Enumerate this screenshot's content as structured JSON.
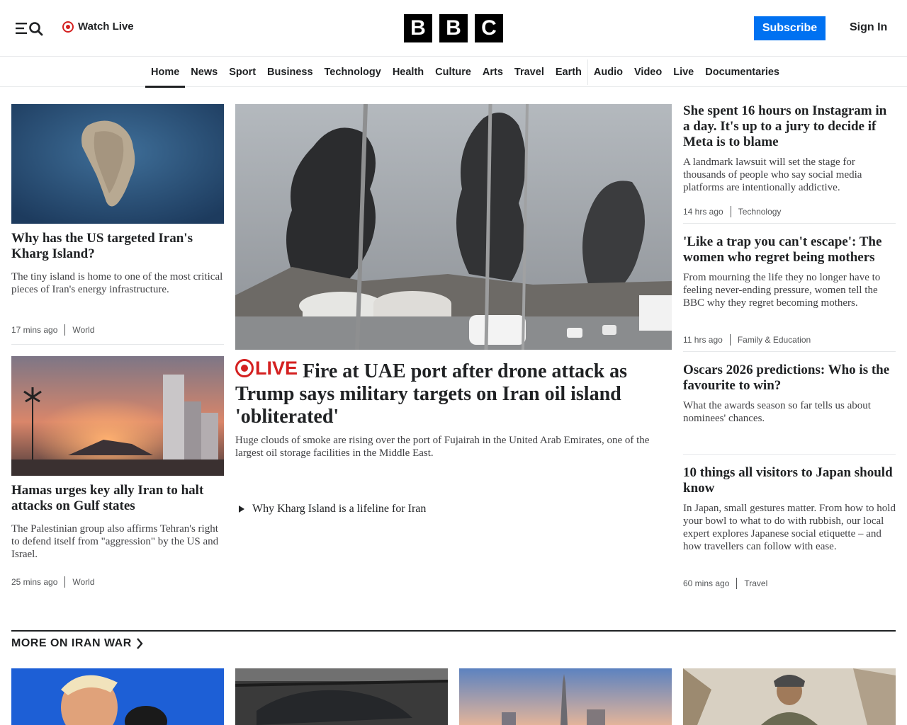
{
  "header": {
    "watch_live": "Watch Live",
    "logo_letters": [
      "B",
      "B",
      "C"
    ],
    "subscribe": "Subscribe",
    "sign_in": "Sign In",
    "accent": "#0071f1",
    "live_color": "#d42020"
  },
  "nav": {
    "items": [
      "Home",
      "News",
      "Sport",
      "Business",
      "Technology",
      "Health",
      "Culture",
      "Arts",
      "Travel",
      "Earth",
      "Audio",
      "Video",
      "Live",
      "Documentaries"
    ],
    "active": "Home"
  },
  "left": [
    {
      "headline": "Why has the US targeted Iran's Kharg Island?",
      "summary": "The tiny island is home to one of the most critical pieces of Iran's energy infrastructure.",
      "time": "17 mins ago",
      "section": "World"
    },
    {
      "headline": "Hamas urges key ally Iran to halt attacks on Gulf states",
      "summary": "The Palestinian group also affirms Tehran's right to defend itself from \"aggression\" by the US and Israel.",
      "time": "25 mins ago",
      "section": "World"
    }
  ],
  "main": {
    "live_label": "LIVE",
    "headline": "Fire at UAE port after drone attack as Trump says military targets on Iran oil island 'obliterated'",
    "summary": "Huge clouds of smoke are rising over the port of Fujairah in the United Arab Emirates, one of the largest oil storage facilities in the Middle East.",
    "related": "Why Kharg Island is a lifeline for Iran"
  },
  "right": [
    {
      "headline": "She spent 16 hours on Instagram in a day. It's up to a jury to decide if Meta is to blame",
      "summary": "A landmark lawsuit will set the stage for thousands of people who say social media platforms are intentionally addictive.",
      "time": "14 hrs ago",
      "section": "Technology"
    },
    {
      "headline": "'Like a trap you can't escape': The women who regret being mothers",
      "summary": "From mourning the life they no longer have to feeling never-ending pressure, women tell the BBC why they regret becoming mothers.",
      "time": "11 hrs ago",
      "section": "Family & Education"
    },
    {
      "headline": "Oscars 2026 predictions: Who is the favourite to win?",
      "summary": "What the awards season so far tells us about nominees' chances."
    },
    {
      "headline": "10 things all visitors to Japan should know",
      "summary": "In Japan, small gestures matter. From how to hold your bowl to what to do with rubbish, our local expert explores Japanese social etiquette – and how travellers can follow with ease.",
      "time": "60 mins ago",
      "section": "Travel"
    }
  ],
  "more": {
    "title": "MORE ON IRAN WAR"
  }
}
